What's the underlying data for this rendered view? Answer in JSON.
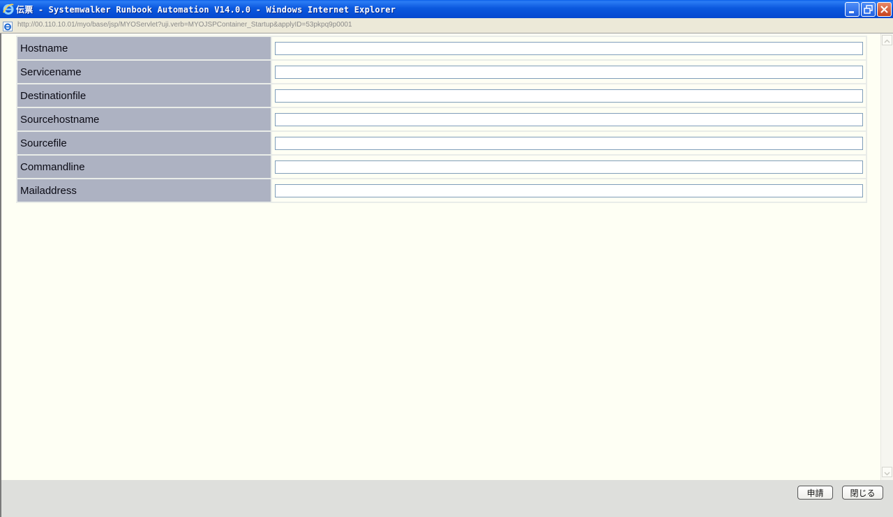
{
  "window": {
    "title": "伝票 - Systemwalker Runbook Automation V14.0.0 - Windows Internet Explorer",
    "icon": "ie-icon"
  },
  "address_bar": {
    "url": "http://00.110.10.01/myo/base/jsp/MYOServlet?uji.verb=MYOJSPContainer_Startup&applyID=53pkpq9p0001",
    "icon": "ie-page-icon"
  },
  "form": {
    "rows": [
      {
        "label": "Hostname",
        "value": ""
      },
      {
        "label": "Servicename",
        "value": ""
      },
      {
        "label": "Destinationfile",
        "value": ""
      },
      {
        "label": "Sourcehostname",
        "value": ""
      },
      {
        "label": "Sourcefile",
        "value": ""
      },
      {
        "label": "Commandline",
        "value": ""
      },
      {
        "label": "Mailaddress",
        "value": ""
      }
    ]
  },
  "footer": {
    "apply_label": "申請",
    "close_label": "閉じる"
  },
  "colors": {
    "titlebar": "#0b58de",
    "label_bg": "#adb2c2",
    "content_bg": "#fefff4",
    "footer_bg": "#dedfdc"
  }
}
